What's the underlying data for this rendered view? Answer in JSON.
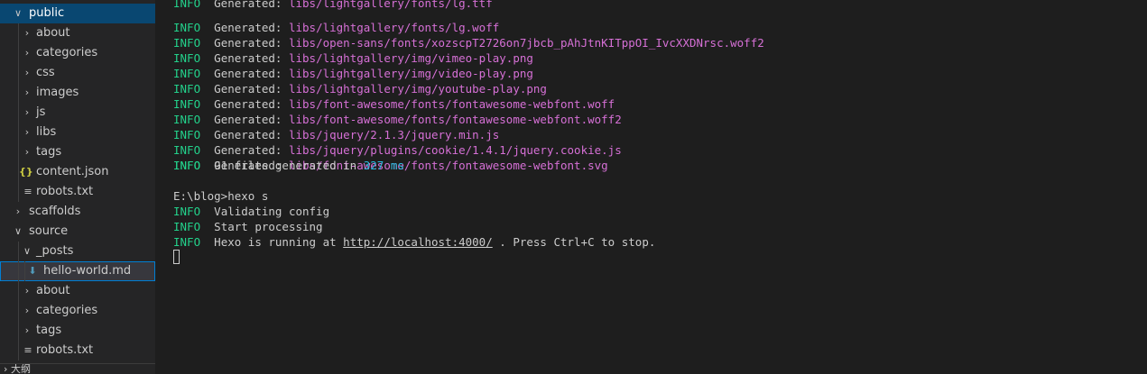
{
  "sidebar": {
    "items": [
      {
        "label": "public",
        "kind": "folder-open"
      },
      {
        "label": "about",
        "kind": "folder"
      },
      {
        "label": "categories",
        "kind": "folder"
      },
      {
        "label": "css",
        "kind": "folder"
      },
      {
        "label": "images",
        "kind": "folder"
      },
      {
        "label": "js",
        "kind": "folder"
      },
      {
        "label": "libs",
        "kind": "folder"
      },
      {
        "label": "tags",
        "kind": "folder"
      },
      {
        "label": "content.json",
        "kind": "json"
      },
      {
        "label": "robots.txt",
        "kind": "txt"
      },
      {
        "label": "scaffolds",
        "kind": "folder"
      },
      {
        "label": "source",
        "kind": "folder-open"
      },
      {
        "label": "_posts",
        "kind": "folder-open"
      },
      {
        "label": "hello-world.md",
        "kind": "md"
      },
      {
        "label": "about",
        "kind": "folder"
      },
      {
        "label": "categories",
        "kind": "folder"
      },
      {
        "label": "tags",
        "kind": "folder"
      },
      {
        "label": "robots.txt",
        "kind": "txt"
      }
    ],
    "outline_label": "大纲"
  },
  "terminal": {
    "lines": [
      {
        "level": "INFO",
        "prefix": "Generated: ",
        "path": "libs/lightgallery/fonts/lg.woff"
      },
      {
        "level": "INFO",
        "prefix": "Generated: ",
        "path": "libs/open-sans/fonts/xozscpT2726on7jbcb_pAhJtnKITppOI_IvcXXDNrsc.woff2"
      },
      {
        "level": "INFO",
        "prefix": "Generated: ",
        "path": "libs/lightgallery/img/vimeo-play.png"
      },
      {
        "level": "INFO",
        "prefix": "Generated: ",
        "path": "libs/lightgallery/img/video-play.png"
      },
      {
        "level": "INFO",
        "prefix": "Generated: ",
        "path": "libs/lightgallery/img/youtube-play.png"
      },
      {
        "level": "INFO",
        "prefix": "Generated: ",
        "path": "libs/font-awesome/fonts/fontawesome-webfont.woff"
      },
      {
        "level": "INFO",
        "prefix": "Generated: ",
        "path": "libs/font-awesome/fonts/fontawesome-webfont.woff2"
      },
      {
        "level": "INFO",
        "prefix": "Generated: ",
        "path": "libs/jquery/2.1.3/jquery.min.js"
      },
      {
        "level": "INFO",
        "prefix": "Generated: ",
        "path": "libs/jquery/plugins/cookie/1.4.1/jquery.cookie.js"
      },
      {
        "level": "INFO",
        "prefix": "Generated: ",
        "path": "libs/font-awesome/fonts/fontawesome-webfont.svg"
      }
    ],
    "summary": {
      "level": "INFO",
      "count_text": "91 files generated in ",
      "time": "327 ms"
    },
    "prompt": "E:\\blog>hexo s",
    "status_lines": [
      {
        "level": "INFO",
        "text": "Validating config"
      },
      {
        "level": "INFO",
        "text": "Start processing"
      }
    ],
    "running": {
      "level": "INFO",
      "before": "Hexo is running at ",
      "url": "http://localhost:4000/",
      "after": " . Press Ctrl+C to stop."
    }
  }
}
